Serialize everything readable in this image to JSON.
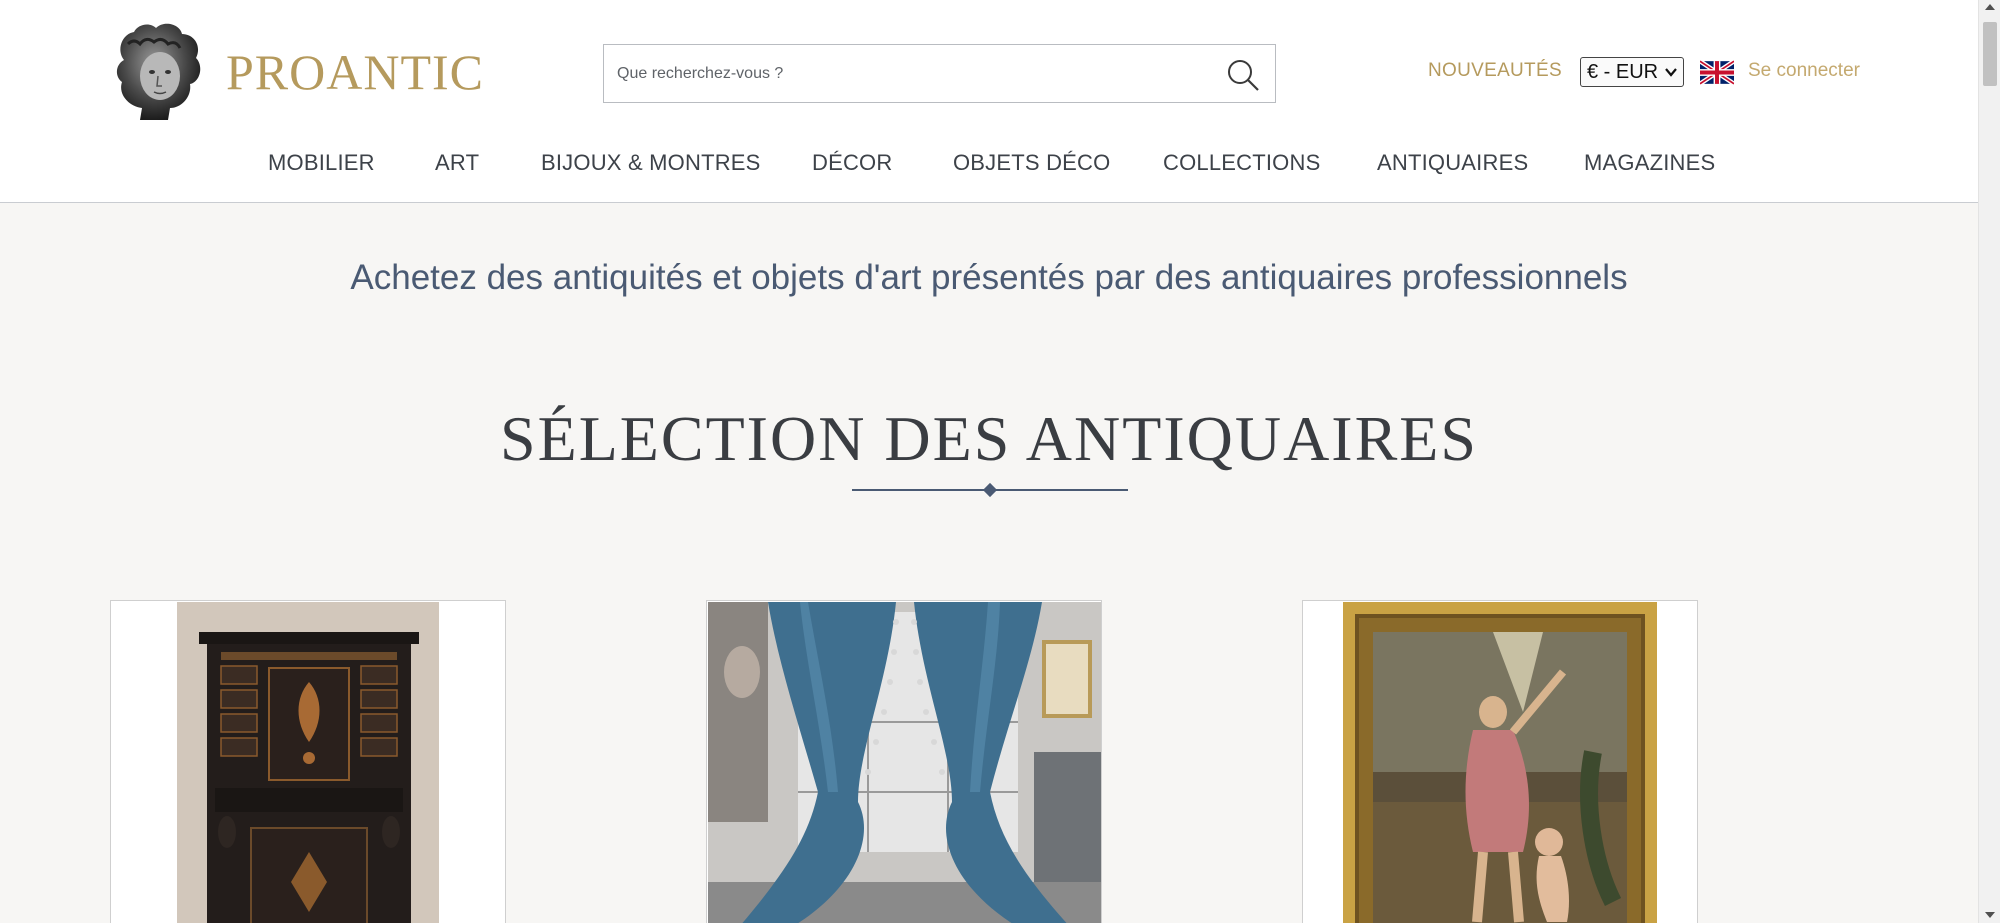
{
  "brand": {
    "name": "PROANTIC",
    "color": "#b59a5d"
  },
  "search": {
    "placeholder": "Que recherchez-vous ?",
    "value": ""
  },
  "header_links": {
    "new_label": "NOUVEAUTÉS",
    "login_label": "Se connecter"
  },
  "currency": {
    "selected": "€ - EUR"
  },
  "language": {
    "flag": "uk-flag-icon"
  },
  "nav": {
    "items": [
      {
        "label": "MOBILIER"
      },
      {
        "label": "ART"
      },
      {
        "label": "BIJOUX & MONTRES"
      },
      {
        "label": "DÉCOR"
      },
      {
        "label": "OBJETS DÉCO"
      },
      {
        "label": "COLLECTIONS"
      },
      {
        "label": "ANTIQUAIRES"
      },
      {
        "label": "MAGAZINES"
      }
    ]
  },
  "main": {
    "tagline": "Achetez des antiquités et objets d'art présentés par des antiquaires professionnels",
    "section_title": "SÉLECTION DES ANTIQUAIRES",
    "products": [
      {
        "image": "ebony-cabinet-image"
      },
      {
        "image": "blue-curtains-image"
      },
      {
        "image": "gilt-framed-painting-image"
      }
    ]
  },
  "colors": {
    "accent_gold": "#b59a5d",
    "tagline_blue": "#4a5a73",
    "nav_text": "#3d4249"
  }
}
